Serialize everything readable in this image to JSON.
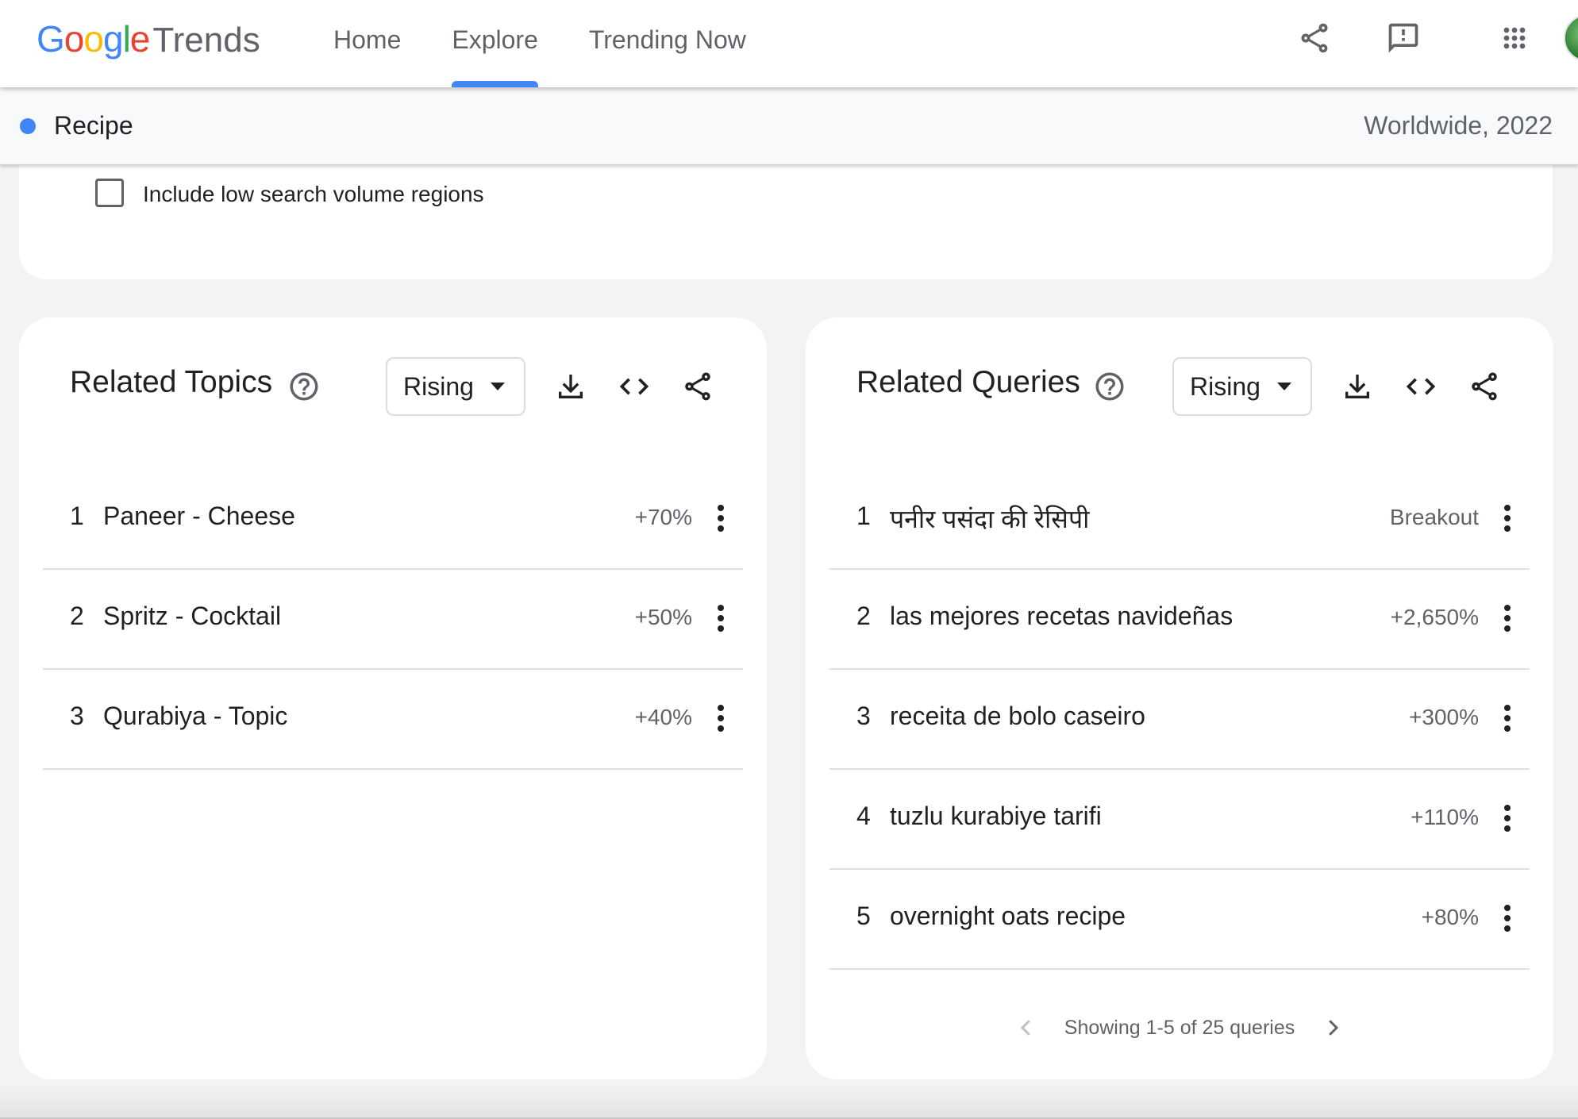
{
  "header": {
    "logo": {
      "google_letters": [
        {
          "ch": "G",
          "color": "#4285F4"
        },
        {
          "ch": "o",
          "color": "#EA4335"
        },
        {
          "ch": "o",
          "color": "#FBBC05"
        },
        {
          "ch": "g",
          "color": "#4285F4"
        },
        {
          "ch": "l",
          "color": "#34A853"
        },
        {
          "ch": "e",
          "color": "#EA4335"
        }
      ],
      "trends": "Trends"
    },
    "nav": [
      {
        "label": "Home",
        "active": false
      },
      {
        "label": "Explore",
        "active": true
      },
      {
        "label": "Trending Now",
        "active": false
      }
    ],
    "icons": [
      "share-icon",
      "feedback-icon",
      "apps-grid-icon",
      "avatar"
    ],
    "accent_color": "#4285F4"
  },
  "term_bar": {
    "term": "Recipe",
    "dot_color": "#4285F4",
    "meta": "Worldwide, 2022"
  },
  "region_options": {
    "low_volume_label": "Include low search volume regions",
    "checked": false
  },
  "related_topics": {
    "title": "Related Topics",
    "filter": "Rising",
    "rows": [
      {
        "rank": "1",
        "name": "Paneer - Cheese",
        "value": "+70%"
      },
      {
        "rank": "2",
        "name": "Spritz - Cocktail",
        "value": "+50%"
      },
      {
        "rank": "3",
        "name": "Qurabiya - Topic",
        "value": "+40%"
      }
    ]
  },
  "related_queries": {
    "title": "Related Queries",
    "filter": "Rising",
    "rows": [
      {
        "rank": "1",
        "name": "पनीर पसंदा की रेसिपी",
        "value": "Breakout"
      },
      {
        "rank": "2",
        "name": "las mejores recetas navideñas",
        "value": "+2,650%"
      },
      {
        "rank": "3",
        "name": "receita de bolo caseiro",
        "value": "+300%"
      },
      {
        "rank": "4",
        "name": "tuzlu kurabiye tarifi",
        "value": "+110%"
      },
      {
        "rank": "5",
        "name": "overnight oats recipe",
        "value": "+80%"
      }
    ],
    "pagination": "Showing 1-5 of 25 queries"
  }
}
